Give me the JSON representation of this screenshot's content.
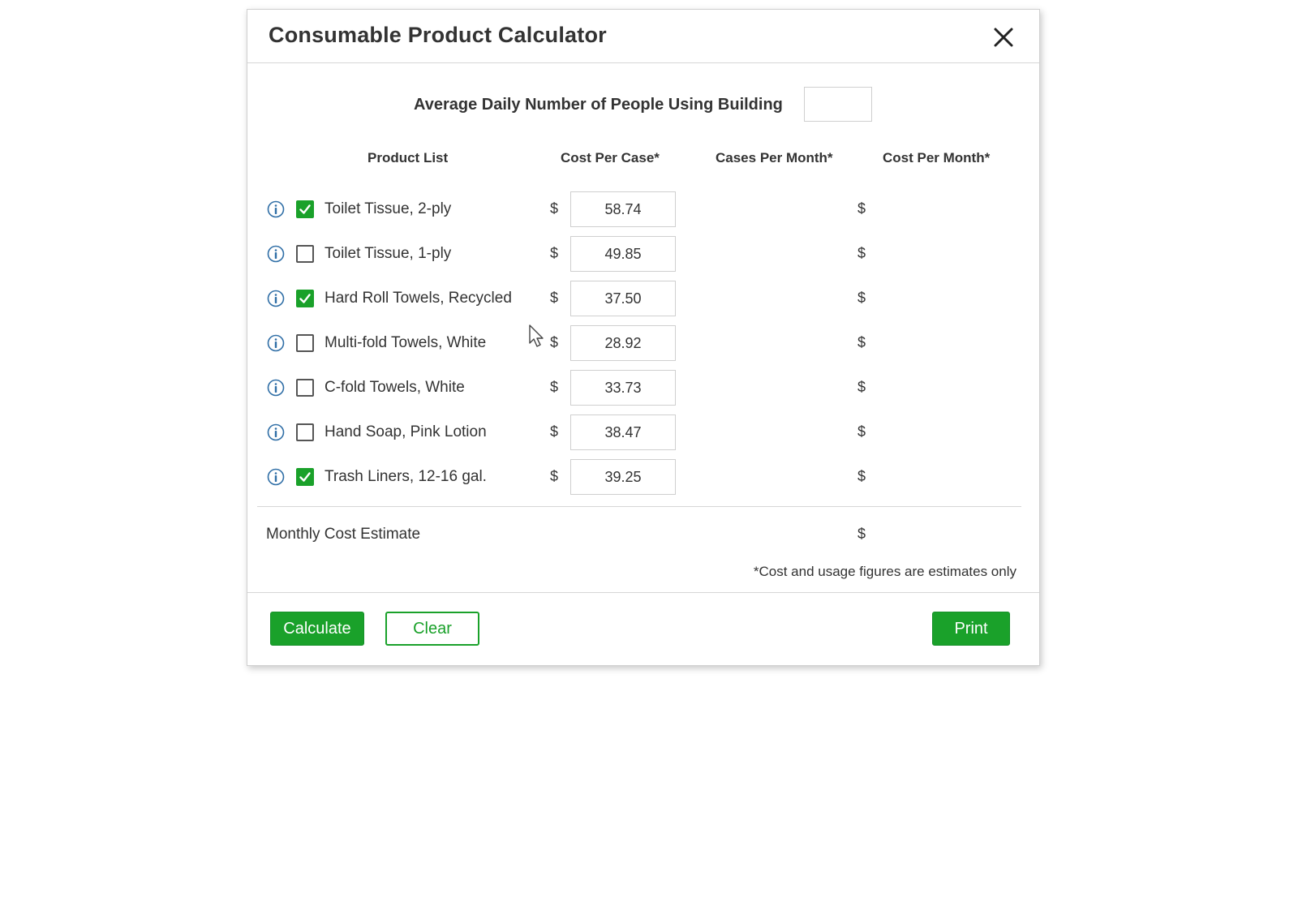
{
  "dialog": {
    "title": "Consumable Product Calculator",
    "close_icon": "close-icon"
  },
  "people": {
    "label": "Average Daily Number of People Using Building",
    "value": ""
  },
  "columns": {
    "product_list": "Product List",
    "cost_per_case": "Cost Per Case*",
    "cases_per_month": "Cases Per Month*",
    "cost_per_month": "Cost Per Month*"
  },
  "currency_symbol": "$",
  "products": [
    {
      "name": "Toilet Tissue, 2-ply",
      "checked": true,
      "cost": "58.74",
      "cases": "",
      "cost_month": ""
    },
    {
      "name": "Toilet Tissue, 1-ply",
      "checked": false,
      "cost": "49.85",
      "cases": "",
      "cost_month": ""
    },
    {
      "name": "Hard Roll Towels, Recycled",
      "checked": true,
      "cost": "37.50",
      "cases": "",
      "cost_month": ""
    },
    {
      "name": "Multi-fold Towels, White",
      "checked": false,
      "cost": "28.92",
      "cases": "",
      "cost_month": ""
    },
    {
      "name": "C-fold Towels, White",
      "checked": false,
      "cost": "33.73",
      "cases": "",
      "cost_month": ""
    },
    {
      "name": "Hand Soap, Pink Lotion",
      "checked": false,
      "cost": "38.47",
      "cases": "",
      "cost_month": ""
    },
    {
      "name": "Trash Liners, 12-16 gal.",
      "checked": true,
      "cost": "39.25",
      "cases": "",
      "cost_month": ""
    }
  ],
  "summary": {
    "label": "Monthly Cost Estimate",
    "value": "",
    "note": "*Cost and usage figures are estimates only"
  },
  "buttons": {
    "calculate": "Calculate",
    "clear": "Clear",
    "print": "Print"
  },
  "colors": {
    "accent": "#1aa12a",
    "info_icon": "#2f6ea6"
  }
}
